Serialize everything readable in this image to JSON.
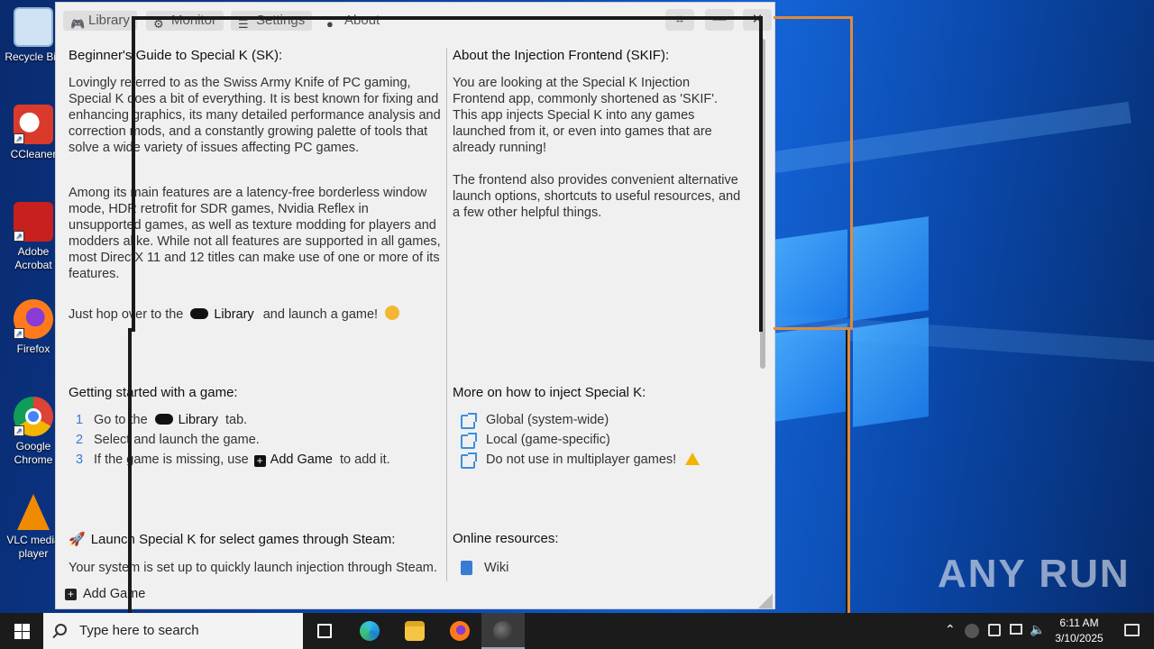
{
  "desktop": {
    "icons": [
      {
        "label": "Recycle Bin",
        "icon": "recycle-bin-icon",
        "color": "#cfe3f5"
      },
      {
        "label": "CCleaner",
        "icon": "ccleaner-icon",
        "color": "#d93a2b"
      },
      {
        "label": "Adobe Acrobat",
        "icon": "acrobat-icon",
        "color": "#c8201e"
      },
      {
        "label": "Firefox",
        "icon": "firefox-icon",
        "color": "#ff7a1a"
      },
      {
        "label": "Google Chrome",
        "icon": "chrome-icon",
        "color": "#2f8f3a"
      },
      {
        "label": "VLC media player",
        "icon": "vlc-icon",
        "color": "#f08a00"
      }
    ],
    "watermark": "ANY RUN"
  },
  "app": {
    "tabs": [
      {
        "label": "Library",
        "icon": "gamepad-icon"
      },
      {
        "label": "Monitor",
        "icon": "gear-icon"
      },
      {
        "label": "Settings",
        "icon": "list-icon"
      },
      {
        "label": "About",
        "icon": "chat-icon"
      }
    ],
    "window_buttons": [
      "collapse-icon",
      "minimize-icon",
      "close-icon"
    ],
    "left": {
      "guide_title": "Beginner's Guide to Special K (SK):",
      "guide_p1": "Lovingly referred to as the Swiss Army Knife of PC gaming, Special K does a bit of everything. It is best known for fixing and enhancing graphics, its many detailed performance analysis and correction mods, and a constantly growing palette of tools that solve a wide variety of issues affecting PC games.",
      "guide_p2": "Among its main features are a latency-free borderless window mode, HDR retrofit for SDR games, Nvidia Reflex in unsupported games, as well as texture modding for players and modders alike. While not all features are supported in all games, most DirectX 11 and 12 titles can make use of one or more of its features.",
      "hop_pre": "Just hop over to the",
      "hop_link": "Library",
      "hop_post": "and launch a game!",
      "started_title": "Getting started with a game:",
      "steps": [
        {
          "num": "1",
          "pre": "Go to the",
          "link": "Library",
          "post": "tab."
        },
        {
          "num": "2",
          "pre": "Select and launch the game.",
          "link": "",
          "post": ""
        },
        {
          "num": "3",
          "pre": "If the game is missing, use",
          "link": "Add Game",
          "post": "to add it."
        }
      ],
      "steam_title": "Launch Special K for select games through Steam:",
      "steam_p": "Your system is set up to quickly launch injection through Steam."
    },
    "right": {
      "skif_title": "About the Injection Frontend (SKIF):",
      "skif_p1": "You are looking at the Special K Injection Frontend app, commonly shortened as 'SKIF'. This app injects Special K into any games launched from it, or even into games that are already running!",
      "skif_p2": "The frontend also provides convenient alternative launch options, shortcuts to useful resources, and a few other helpful things.",
      "inject_title": "More on how to inject Special K:",
      "inject_links": [
        {
          "label": "Global (system-wide)"
        },
        {
          "label": "Local (game-specific)"
        },
        {
          "label": "Do not use in multiplayer games!"
        }
      ],
      "online_title": "Online resources:",
      "online_links": [
        {
          "label": "Wiki"
        }
      ]
    },
    "footer": {
      "add_game": "Add Game"
    }
  },
  "taskbar": {
    "search_placeholder": "Type here to search",
    "apps": [
      "task-view-icon",
      "edge-icon",
      "file-explorer-icon",
      "firefox-icon",
      "special-k-icon"
    ],
    "time": "6:11 AM",
    "date": "3/10/2025"
  }
}
